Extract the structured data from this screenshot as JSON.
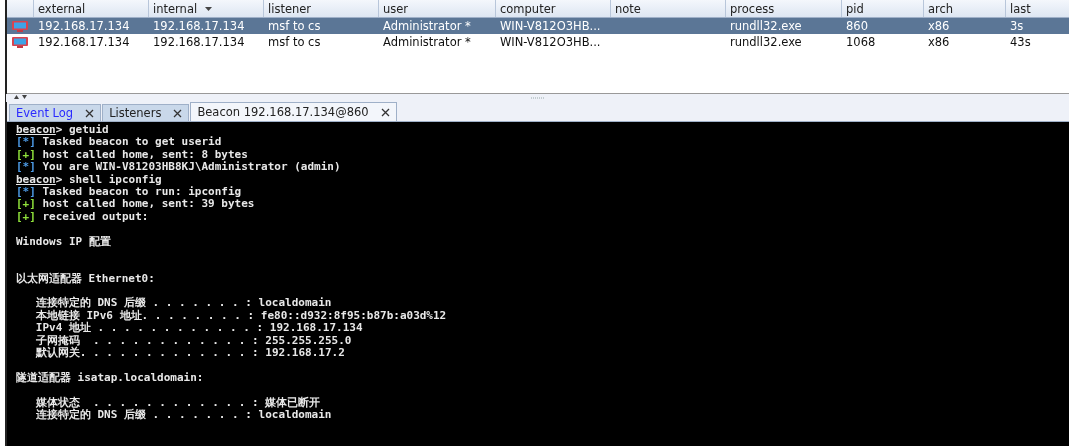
{
  "table": {
    "columns": [
      {
        "label": "external",
        "sorted": false
      },
      {
        "label": "internal",
        "sorted": true
      },
      {
        "label": "listener",
        "sorted": false
      },
      {
        "label": "user",
        "sorted": false
      },
      {
        "label": "computer",
        "sorted": false
      },
      {
        "label": "note",
        "sorted": false
      },
      {
        "label": "process",
        "sorted": false
      },
      {
        "label": "pid",
        "sorted": false
      },
      {
        "label": "arch",
        "sorted": false
      },
      {
        "label": "last",
        "sorted": false
      }
    ],
    "rows": [
      {
        "selected": true,
        "cells": [
          "192.168.17.134",
          "192.168.17.134",
          "msf to cs",
          "Administrator *",
          "WIN-V812O3HB...",
          "",
          "rundll32.exe",
          "860",
          "x86",
          "3s"
        ]
      },
      {
        "selected": false,
        "cells": [
          "192.168.17.134",
          "192.168.17.134",
          "msf to cs",
          "Administrator *",
          "WIN-V812O3HB...",
          "",
          "rundll32.exe",
          "1068",
          "x86",
          "43s"
        ]
      }
    ]
  },
  "tabs": [
    {
      "label": "Event Log",
      "selected": false,
      "kind": "log"
    },
    {
      "label": "Listeners",
      "selected": false,
      "kind": "plain"
    },
    {
      "label": "Beacon 192.168.17.134@860",
      "selected": true,
      "kind": "plain"
    }
  ],
  "console": [
    {
      "kind": "prompt",
      "prompt": "beacon",
      "text": "> getuid"
    },
    {
      "kind": "info",
      "tag": "[*]",
      "text": " Tasked beacon to get userid"
    },
    {
      "kind": "ok",
      "tag": "[+]",
      "text": " host called home, sent: 8 bytes"
    },
    {
      "kind": "info",
      "tag": "[*]",
      "text": " You are WIN-V81203HB8KJ\\Administrator (admin)"
    },
    {
      "kind": "prompt",
      "prompt": "beacon",
      "text": "> shell ipconfig"
    },
    {
      "kind": "info",
      "tag": "[*]",
      "text": " Tasked beacon to run: ipconfig"
    },
    {
      "kind": "ok",
      "tag": "[+]",
      "text": " host called home, sent: 39 bytes"
    },
    {
      "kind": "ok",
      "tag": "[+]",
      "text": " received output:"
    },
    {
      "kind": "blank"
    },
    {
      "kind": "plain",
      "text": "Windows IP 配置"
    },
    {
      "kind": "blank"
    },
    {
      "kind": "blank"
    },
    {
      "kind": "plain",
      "text": "以太网适配器 Ethernet0:"
    },
    {
      "kind": "blank"
    },
    {
      "kind": "plain",
      "text": "   连接特定的 DNS 后缀 . . . . . . . : localdomain"
    },
    {
      "kind": "plain",
      "text": "   本地链接 IPv6 地址. . . . . . . . : fe80::d932:8f95:b87b:a03d%12"
    },
    {
      "kind": "plain",
      "text": "   IPv4 地址 . . . . . . . . . . . . : 192.168.17.134"
    },
    {
      "kind": "plain",
      "text": "   子网掩码  . . . . . . . . . . . . : 255.255.255.0"
    },
    {
      "kind": "plain",
      "text": "   默认网关. . . . . . . . . . . . . : 192.168.17.2"
    },
    {
      "kind": "blank"
    },
    {
      "kind": "plain",
      "text": "隧道适配器 isatap.localdomain:"
    },
    {
      "kind": "blank"
    },
    {
      "kind": "plain",
      "text": "   媒体状态  . . . . . . . . . . . . : 媒体已断开"
    },
    {
      "kind": "plain",
      "text": "   连接特定的 DNS 后缀 . . . . . . . : localdomain"
    }
  ]
}
